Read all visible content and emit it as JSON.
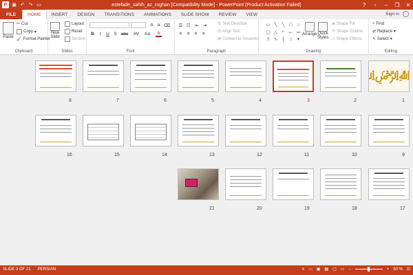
{
  "app": {
    "title": "estefade_sahih_az_roghan [Compatibility Mode] - PowerPoint (Product Activation Failed)",
    "logo": "P"
  },
  "qat": {
    "save_icon": "save-icon",
    "undo_icon": "undo-icon",
    "redo_icon": "redo-icon",
    "present_icon": "present-icon"
  },
  "window": {
    "help": "?",
    "minimize": "–",
    "restore": "❐",
    "close": "✕"
  },
  "tabs": [
    "FILE",
    "HOME",
    "INSERT",
    "DESIGN",
    "TRANSITIONS",
    "ANIMATIONS",
    "SLIDE SHOW",
    "REVIEW",
    "VIEW"
  ],
  "account": {
    "sign_in": "Sign in"
  },
  "ribbon": {
    "clipboard": {
      "label": "Clipboard",
      "paste": "Paste",
      "cut": "Cut",
      "copy": "Copy",
      "format_painter": "Format Painter"
    },
    "slides": {
      "label": "Slides",
      "new_slide_line1": "New",
      "new_slide_line2": "Slide",
      "layout": "Layout",
      "reset": "Reset",
      "section": "Section"
    },
    "font": {
      "label": "Font",
      "font_name": "",
      "font_size": "",
      "bold": "B",
      "italic": "I",
      "underline": "U",
      "shadow": "S",
      "strike": "abc",
      "spacing": "AV",
      "case": "Aa",
      "color": "A"
    },
    "paragraph": {
      "label": "Paragraph",
      "text_direction": "Text Direction",
      "align_text": "Align Text",
      "convert_smartart": "Convert to SmartArt"
    },
    "drawing": {
      "label": "Drawing",
      "arrange": "Arrange",
      "quick_styles_line1": "Quick",
      "quick_styles_line2": "Styles",
      "shape_fill": "Shape Fill",
      "shape_outline": "Shape Outline",
      "shape_effects": "Shape Effects"
    },
    "editing": {
      "label": "Editing",
      "find": "Find",
      "replace": "Replace",
      "select": "Select"
    }
  },
  "slides": [
    {
      "num": "1"
    },
    {
      "num": "2"
    },
    {
      "num": "3"
    },
    {
      "num": "4"
    },
    {
      "num": "5"
    },
    {
      "num": "6"
    },
    {
      "num": "7"
    },
    {
      "num": "8"
    },
    {
      "num": "9"
    },
    {
      "num": "10"
    },
    {
      "num": "11"
    },
    {
      "num": "12"
    },
    {
      "num": "13"
    },
    {
      "num": "14"
    },
    {
      "num": "15"
    },
    {
      "num": "16"
    },
    {
      "num": "17"
    },
    {
      "num": "18"
    },
    {
      "num": "19"
    },
    {
      "num": "20"
    },
    {
      "num": "21"
    }
  ],
  "selected_slide": "3",
  "status": {
    "slide_info": "SLIDE 3 OF 21",
    "language": "PERSIAN",
    "zoom": "50 %",
    "zoom_minus": "–",
    "zoom_plus": "+",
    "fit": "⊡"
  }
}
